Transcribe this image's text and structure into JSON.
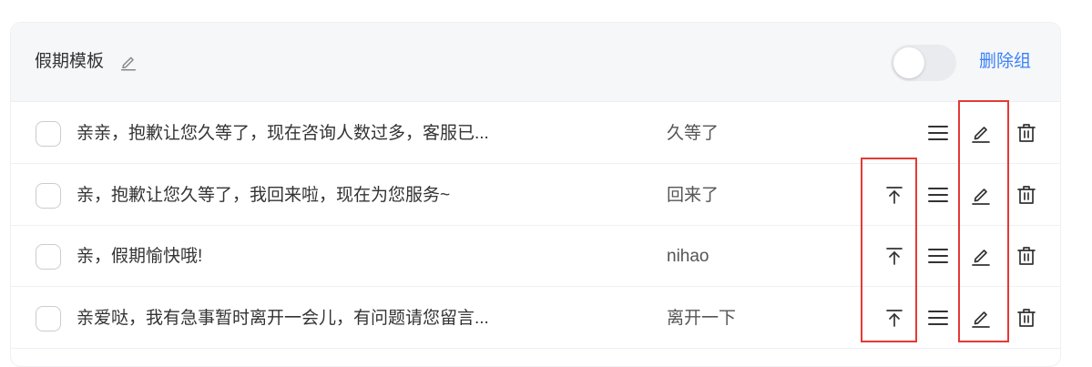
{
  "group": {
    "title": "假期模板",
    "delete_label": "删除组",
    "toggle_on": false
  },
  "rows": [
    {
      "message": "亲亲，抱歉让您久等了，现在咨询人数过多，客服已...",
      "tag": "久等了",
      "show_top": false
    },
    {
      "message": "亲，抱歉让您久等了，我回来啦，现在为您服务~",
      "tag": "回来了",
      "show_top": true
    },
    {
      "message": "亲，假期愉快哦!",
      "tag": "nihao",
      "show_top": true
    },
    {
      "message": "亲爱哒，我有急事暂时离开一会儿，有问题请您留言...",
      "tag": "离开一下",
      "show_top": true
    }
  ],
  "icons": {
    "title_edit": "pencil-icon",
    "pin_top": "pin-to-top-icon",
    "sort": "drag-menu-icon",
    "edit": "pencil-icon",
    "delete": "trash-icon"
  },
  "colors": {
    "accent": "#3b82f6",
    "highlight": "#e53935",
    "header_bg": "#f6f7f9"
  }
}
